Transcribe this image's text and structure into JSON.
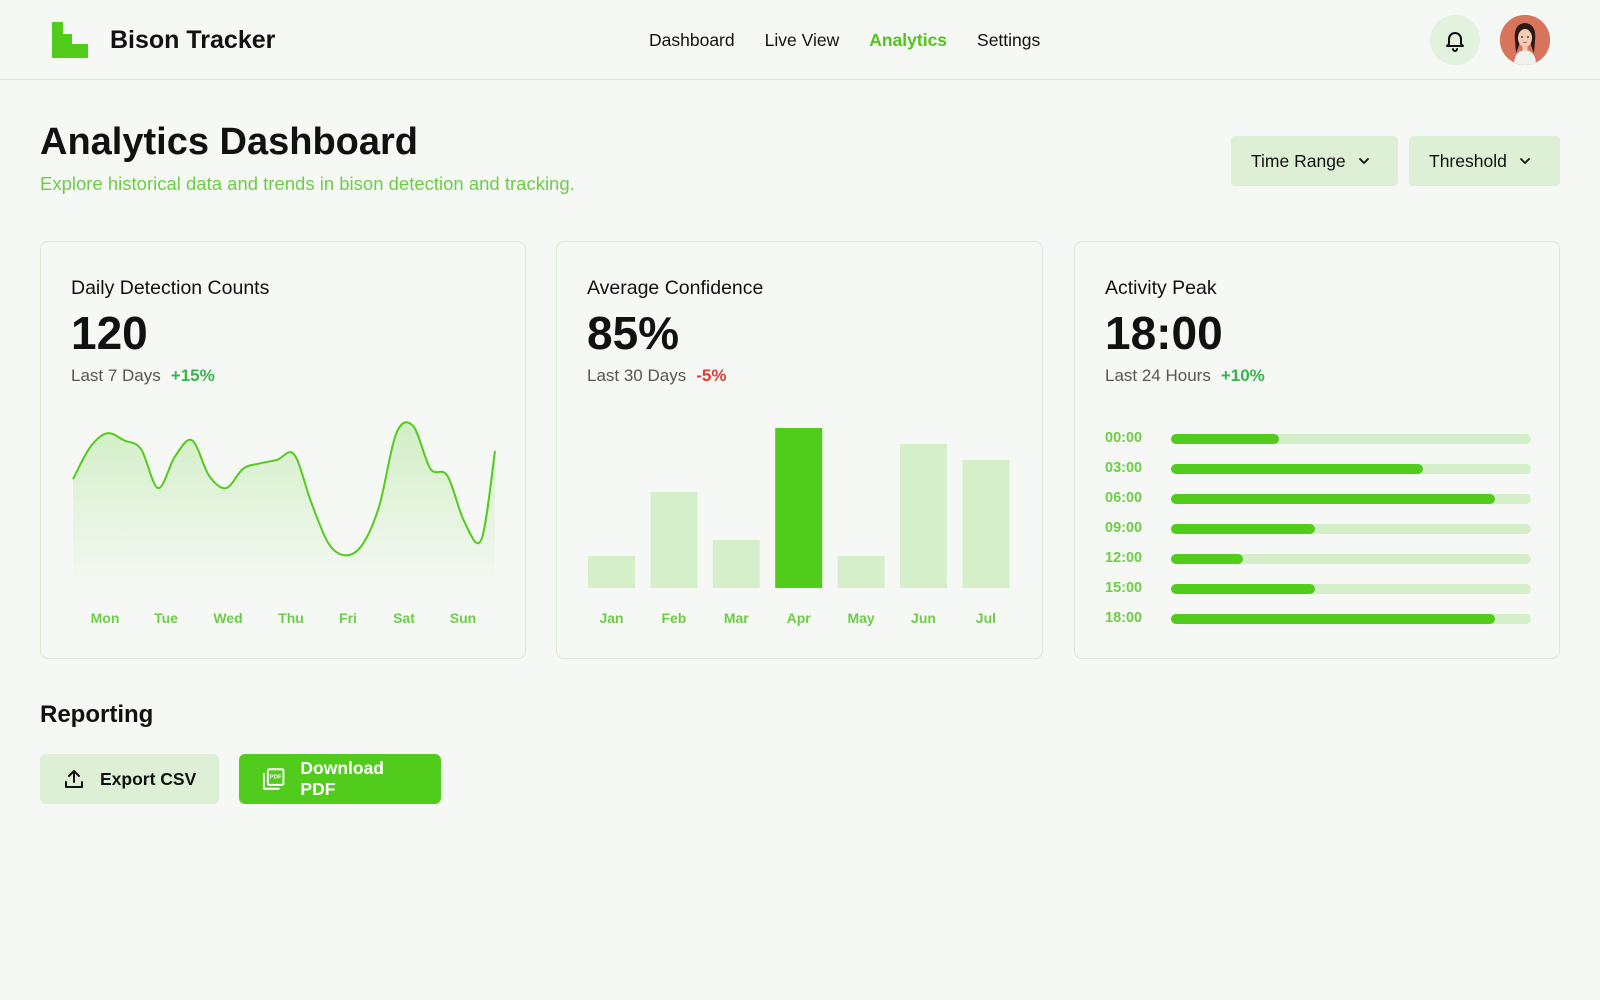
{
  "header": {
    "brand": "Bison Tracker",
    "nav": [
      {
        "label": "Dashboard",
        "active": false
      },
      {
        "label": "Live View",
        "active": false
      },
      {
        "label": "Analytics",
        "active": true
      },
      {
        "label": "Settings",
        "active": false
      }
    ],
    "icons": {
      "notifications": "bell-icon",
      "profile": "user-avatar"
    }
  },
  "page": {
    "title": "Analytics Dashboard",
    "subtitle": "Explore historical data and trends in bison detection and tracking.",
    "filters": [
      {
        "label": "Time Range",
        "icon": "chevron-down-icon"
      },
      {
        "label": "Threshold",
        "icon": "chevron-down-icon"
      }
    ]
  },
  "cards": [
    {
      "title": "Daily Detection Counts",
      "value": "120",
      "period": "Last 7 Days",
      "delta": "+15%"
    },
    {
      "title": "Average Confidence",
      "value": "85%",
      "period": "Last 30 Days",
      "delta": "-5%"
    },
    {
      "title": "Activity Peak",
      "value": "18:00",
      "period": "Last 24 Hours",
      "delta": "+10%"
    }
  ],
  "colors": {
    "accent": "#52cc1c",
    "accent_light": "#d6efcb",
    "accent_text": "#6cce45",
    "positive": "#38b54a",
    "negative": "#e53935"
  },
  "chart_data": [
    {
      "type": "area",
      "categories": [
        "Mon",
        "Tue",
        "Wed",
        "Thu",
        "Fri",
        "Sat",
        "Sun"
      ],
      "x": [
        0,
        0.25,
        0.5,
        0.75,
        1,
        1.25,
        1.5,
        1.75,
        2,
        2.25,
        2.5,
        2.75,
        3,
        3.25,
        3.5,
        3.75,
        4,
        4.25,
        4.5,
        4.75,
        5,
        5.25,
        5.5,
        5.75,
        6,
        6.2
      ],
      "values": [
        62,
        80,
        88,
        84,
        79,
        57,
        75,
        84,
        64,
        57,
        68,
        71,
        73,
        76,
        49,
        26,
        19,
        25,
        47,
        88,
        92,
        68,
        64,
        38,
        28,
        78
      ],
      "ylim": [
        0,
        100
      ]
    },
    {
      "type": "bar",
      "categories": [
        "Jan",
        "Feb",
        "Mar",
        "Apr",
        "May",
        "Jun",
        "Jul"
      ],
      "values": [
        20,
        60,
        30,
        100,
        20,
        90,
        80
      ],
      "highlight": "Apr",
      "ylim": [
        0,
        100
      ]
    },
    {
      "type": "bar",
      "orientation": "horizontal",
      "categories": [
        "00:00",
        "03:00",
        "06:00",
        "09:00",
        "12:00",
        "15:00",
        "18:00"
      ],
      "values": [
        30,
        70,
        90,
        40,
        20,
        40,
        90
      ],
      "xlim": [
        0,
        100
      ]
    }
  ],
  "reporting": {
    "title": "Reporting",
    "buttons": [
      {
        "label": "Export CSV",
        "icon": "upload-icon"
      },
      {
        "label": "Download PDF",
        "icon": "pdf-icon"
      }
    ]
  }
}
